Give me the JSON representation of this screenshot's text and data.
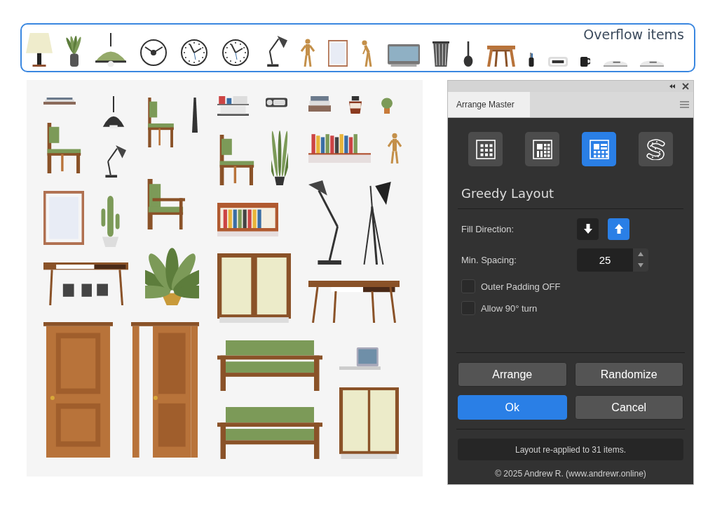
{
  "overflow": {
    "title": "Overflow items"
  },
  "panel": {
    "title": "Arrange Master",
    "modes": [
      {
        "selected": false
      },
      {
        "selected": false
      },
      {
        "selected": true
      },
      {
        "selected": false
      }
    ],
    "heading": "Greedy Layout",
    "fill_direction": {
      "label": "Fill Direction:",
      "options": [
        {
          "selected": false
        },
        {
          "selected": true
        }
      ]
    },
    "min_spacing": {
      "label": "Min. Spacing:",
      "value": "25"
    },
    "checkboxes": [
      {
        "label": "Outer Padding OFF",
        "checked": false
      },
      {
        "label": "Allow 90° turn",
        "checked": false
      }
    ],
    "buttons": [
      {
        "label": "Arrange",
        "kind": "secondary"
      },
      {
        "label": "Randomize",
        "kind": "secondary"
      },
      {
        "label": "Ok",
        "kind": "primary"
      },
      {
        "label": "Cancel",
        "kind": "secondary"
      }
    ],
    "status": "Layout re-applied to 31 items.",
    "footer": "© 2025 Andrew R. (www.andrewr.online)"
  }
}
